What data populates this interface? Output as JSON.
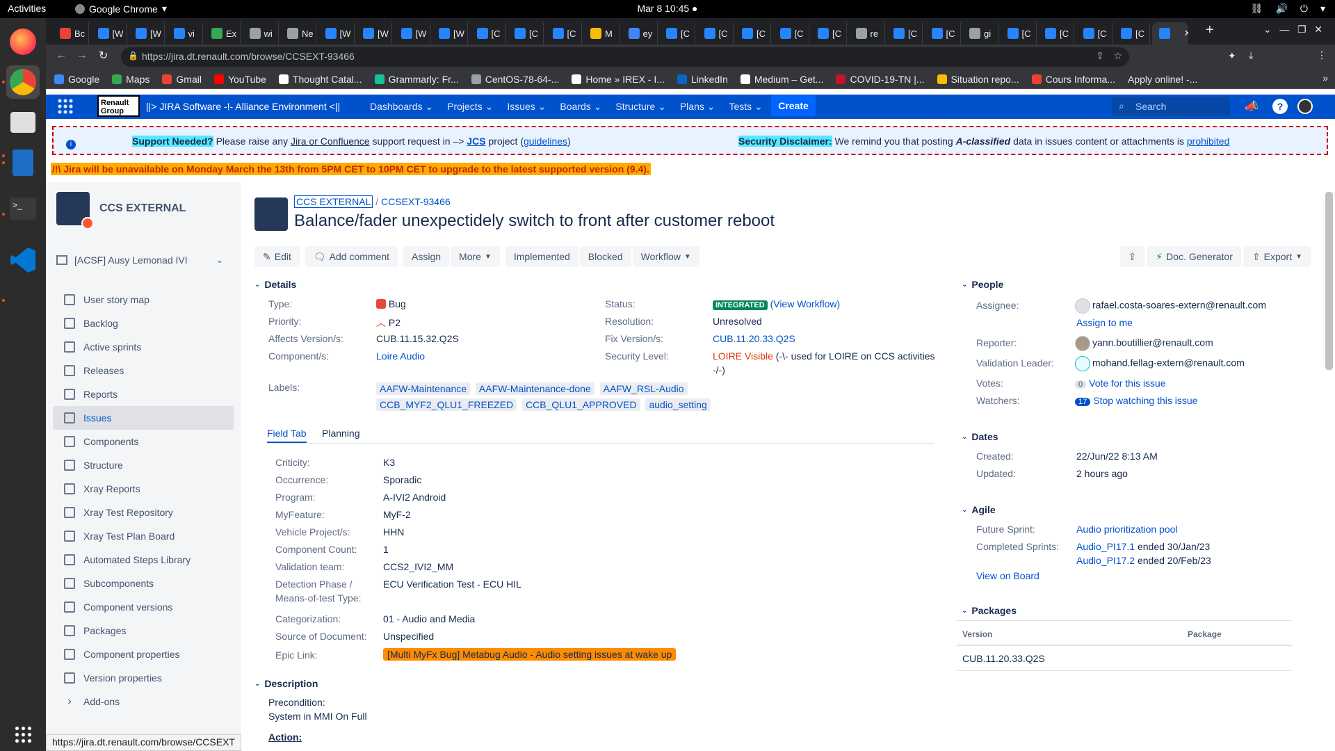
{
  "os": {
    "activities": "Activities",
    "app_name": "Google Chrome",
    "clock": "Mar 8  10:45"
  },
  "browser": {
    "tabs": [
      "Bc",
      "[W",
      "[W",
      "vi",
      "Ex",
      "wi",
      "Ne",
      "[W",
      "[W",
      "[W",
      "[W",
      "[C",
      "[C",
      "[C",
      "M",
      "ey",
      "[C",
      "[C",
      "[C",
      "[C",
      "[C",
      "re",
      "[C",
      "[C",
      "gi",
      "[C",
      "[C",
      "[C",
      "[C",
      ""
    ],
    "url": "https://jira.dt.renault.com/browse/CCSEXT-93466",
    "bookmarks": [
      "Google",
      "Maps",
      "Gmail",
      "YouTube",
      "Thought Catal...",
      "Grammarly: Fr...",
      "CentOS-78-64-...",
      "Home » IREX - I...",
      "LinkedIn",
      "Medium – Get...",
      "COVID-19-TN |...",
      "Situation repo...",
      "Cours Informa...",
      "Apply online! -..."
    ],
    "status_url": "https://jira.dt.renault.com/browse/CCSEXT"
  },
  "jira_nav": {
    "logo": "Renault Group",
    "title": "||> JIRA Software -!- Alliance Environment <||",
    "menus": [
      "Dashboards",
      "Projects",
      "Issues",
      "Boards",
      "Structure",
      "Plans",
      "Tests"
    ],
    "create": "Create",
    "search_placeholder": "Search"
  },
  "banner": {
    "support_label": "Support Needed?",
    "support_text_1": "Please raise any",
    "support_link": "Jira or Confluence",
    "support_text_2": "support request in –> ",
    "jcs": "JCS",
    "support_text_3": " project  (",
    "guidelines": "guidelines",
    "support_text_4": ")",
    "security_label": "Security Disclaimer:",
    "security_text_1": "We remind you that posting",
    "security_bold": "A-classified",
    "security_text_2": "data in issues content or attachments is",
    "prohibited": "prohibited",
    "warning": "/!\\ Jira will be unavailable on Monday March the 13th from 5PM CET to 10PM CET to upgrade to the latest supported version (9.4)."
  },
  "sidebar": {
    "project": "CCS EXTERNAL",
    "board_selector": "[ACSF] Ausy Lemonad IVI",
    "items": [
      "User story map",
      "Backlog",
      "Active sprints",
      "Releases",
      "Reports",
      "Issues",
      "Components",
      "Structure",
      "Xray Reports",
      "Xray Test Repository",
      "Xray Test Plan Board",
      "Automated Steps Library",
      "Subcomponents",
      "Component versions",
      "Packages",
      "Component properties",
      "Version properties",
      "Add-ons"
    ]
  },
  "issue": {
    "project_link": "CCS EXTERNAL",
    "key": "CCSEXT-93466",
    "title": "Balance/fader unexpectidely switch to front after customer reboot",
    "actions": {
      "edit": "Edit",
      "comment": "Add comment",
      "assign": "Assign",
      "more": "More",
      "implemented": "Implemented",
      "blocked": "Blocked",
      "workflow": "Workflow",
      "doc": "Doc. Generator",
      "export": "Export"
    },
    "details_heading": "Details",
    "type_label": "Type:",
    "type": "Bug",
    "priority_label": "Priority:",
    "priority": "P2",
    "affects_label": "Affects Version/s:",
    "affects": "CUB.11.15.32.Q2S",
    "component_label": "Component/s:",
    "component": "Loire Audio",
    "labels_label": "Labels:",
    "labels": [
      "AAFW-Maintenance",
      "AAFW-Maintenance-done",
      "AAFW_RSL-Audio",
      "CCB_MYF2_QLU1_FREEZED",
      "CCB_QLU1_APPROVED",
      "audio_setting"
    ],
    "status_label": "Status:",
    "status": "INTEGRATED",
    "view_workflow": "(View Workflow)",
    "resolution_label": "Resolution:",
    "resolution": "Unresolved",
    "fix_label": "Fix Version/s:",
    "fix": "CUB.11.20.33.Q2S",
    "security_label": "Security Level:",
    "security_red": "LOIRE Visible",
    "security_rest": "(-\\- used for LOIRE on CCS activities",
    "security_rest2": "-/-)",
    "tabs": [
      "Field Tab",
      "Planning"
    ],
    "fields": [
      {
        "label": "Criticity:",
        "value": "K3"
      },
      {
        "label": "Occurrence:",
        "value": "Sporadic"
      },
      {
        "label": "Program:",
        "value": "A-IVI2 Android"
      },
      {
        "label": "MyFeature:",
        "value": "MyF-2"
      },
      {
        "label": "Vehicle Project/s:",
        "value": "HHN"
      },
      {
        "label": "Component Count:",
        "value": "1"
      },
      {
        "label": "Validation team:",
        "value": "CCS2_IVI2_MM"
      },
      {
        "label": "Detection Phase /",
        "value": "ECU Verification Test - ECU HIL"
      },
      {
        "label": "Means-of-test Type:",
        "value": ""
      },
      {
        "label": "Categorization:",
        "value": "01 - Audio and Media"
      },
      {
        "label": "Source of Document:",
        "value": "Unspecified"
      }
    ],
    "epic_label": "Epic Link:",
    "epic": "[Multi MyFx Bug] Metabug Audio - Audio setting issues at wake up",
    "description_heading": "Description",
    "precondition": "Precondition:",
    "precondition_text": "System in MMI On Full",
    "action": "Action:"
  },
  "people": {
    "heading": "People",
    "assignee_label": "Assignee:",
    "assignee": "rafael.costa-soares-extern@renault.com",
    "assign_me": "Assign to me",
    "reporter_label": "Reporter:",
    "reporter": "yann.boutillier@renault.com",
    "validation_label": "Validation Leader:",
    "validation": "mohand.fellag-extern@renault.com",
    "votes_label": "Votes:",
    "votes_count": "0",
    "votes_link": "Vote for this issue",
    "watchers_label": "Watchers:",
    "watchers_count": "17",
    "watchers_link": "Stop watching this issue"
  },
  "dates": {
    "heading": "Dates",
    "created_label": "Created:",
    "created": "22/Jun/22 8:13 AM",
    "updated_label": "Updated:",
    "updated": "2 hours ago"
  },
  "agile": {
    "heading": "Agile",
    "future_label": "Future Sprint:",
    "future": "Audio prioritization pool",
    "completed_label": "Completed Sprints:",
    "sprint1": "Audio_PI17.1",
    "sprint1_end": " ended 30/Jan/23",
    "sprint2": "Audio_PI17.2",
    "sprint2_end": " ended 20/Feb/23",
    "view_board": "View on Board"
  },
  "packages": {
    "heading": "Packages",
    "col_version": "Version",
    "col_package": "Package",
    "row_version": "CUB.11.20.33.Q2S"
  }
}
